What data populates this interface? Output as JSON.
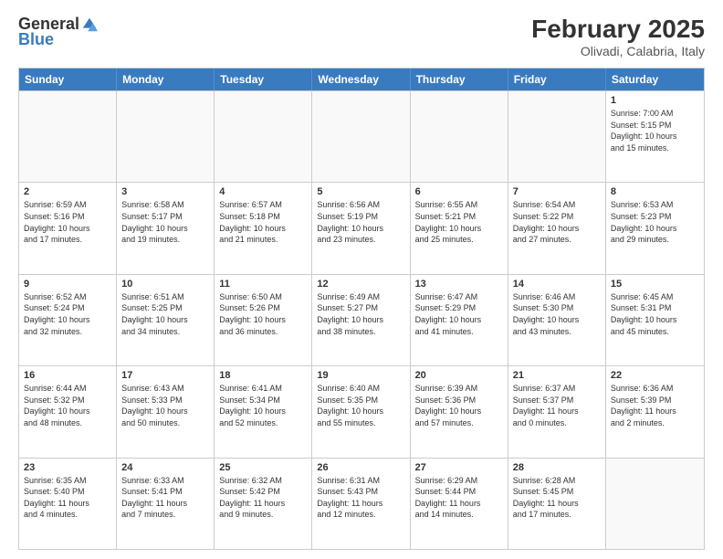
{
  "logo": {
    "general": "General",
    "blue": "Blue"
  },
  "title": {
    "month_year": "February 2025",
    "location": "Olivadi, Calabria, Italy"
  },
  "days_of_week": [
    "Sunday",
    "Monday",
    "Tuesday",
    "Wednesday",
    "Thursday",
    "Friday",
    "Saturday"
  ],
  "weeks": [
    [
      {
        "day": "",
        "info": ""
      },
      {
        "day": "",
        "info": ""
      },
      {
        "day": "",
        "info": ""
      },
      {
        "day": "",
        "info": ""
      },
      {
        "day": "",
        "info": ""
      },
      {
        "day": "",
        "info": ""
      },
      {
        "day": "1",
        "info": "Sunrise: 7:00 AM\nSunset: 5:15 PM\nDaylight: 10 hours\nand 15 minutes."
      }
    ],
    [
      {
        "day": "2",
        "info": "Sunrise: 6:59 AM\nSunset: 5:16 PM\nDaylight: 10 hours\nand 17 minutes."
      },
      {
        "day": "3",
        "info": "Sunrise: 6:58 AM\nSunset: 5:17 PM\nDaylight: 10 hours\nand 19 minutes."
      },
      {
        "day": "4",
        "info": "Sunrise: 6:57 AM\nSunset: 5:18 PM\nDaylight: 10 hours\nand 21 minutes."
      },
      {
        "day": "5",
        "info": "Sunrise: 6:56 AM\nSunset: 5:19 PM\nDaylight: 10 hours\nand 23 minutes."
      },
      {
        "day": "6",
        "info": "Sunrise: 6:55 AM\nSunset: 5:21 PM\nDaylight: 10 hours\nand 25 minutes."
      },
      {
        "day": "7",
        "info": "Sunrise: 6:54 AM\nSunset: 5:22 PM\nDaylight: 10 hours\nand 27 minutes."
      },
      {
        "day": "8",
        "info": "Sunrise: 6:53 AM\nSunset: 5:23 PM\nDaylight: 10 hours\nand 29 minutes."
      }
    ],
    [
      {
        "day": "9",
        "info": "Sunrise: 6:52 AM\nSunset: 5:24 PM\nDaylight: 10 hours\nand 32 minutes."
      },
      {
        "day": "10",
        "info": "Sunrise: 6:51 AM\nSunset: 5:25 PM\nDaylight: 10 hours\nand 34 minutes."
      },
      {
        "day": "11",
        "info": "Sunrise: 6:50 AM\nSunset: 5:26 PM\nDaylight: 10 hours\nand 36 minutes."
      },
      {
        "day": "12",
        "info": "Sunrise: 6:49 AM\nSunset: 5:27 PM\nDaylight: 10 hours\nand 38 minutes."
      },
      {
        "day": "13",
        "info": "Sunrise: 6:47 AM\nSunset: 5:29 PM\nDaylight: 10 hours\nand 41 minutes."
      },
      {
        "day": "14",
        "info": "Sunrise: 6:46 AM\nSunset: 5:30 PM\nDaylight: 10 hours\nand 43 minutes."
      },
      {
        "day": "15",
        "info": "Sunrise: 6:45 AM\nSunset: 5:31 PM\nDaylight: 10 hours\nand 45 minutes."
      }
    ],
    [
      {
        "day": "16",
        "info": "Sunrise: 6:44 AM\nSunset: 5:32 PM\nDaylight: 10 hours\nand 48 minutes."
      },
      {
        "day": "17",
        "info": "Sunrise: 6:43 AM\nSunset: 5:33 PM\nDaylight: 10 hours\nand 50 minutes."
      },
      {
        "day": "18",
        "info": "Sunrise: 6:41 AM\nSunset: 5:34 PM\nDaylight: 10 hours\nand 52 minutes."
      },
      {
        "day": "19",
        "info": "Sunrise: 6:40 AM\nSunset: 5:35 PM\nDaylight: 10 hours\nand 55 minutes."
      },
      {
        "day": "20",
        "info": "Sunrise: 6:39 AM\nSunset: 5:36 PM\nDaylight: 10 hours\nand 57 minutes."
      },
      {
        "day": "21",
        "info": "Sunrise: 6:37 AM\nSunset: 5:37 PM\nDaylight: 11 hours\nand 0 minutes."
      },
      {
        "day": "22",
        "info": "Sunrise: 6:36 AM\nSunset: 5:39 PM\nDaylight: 11 hours\nand 2 minutes."
      }
    ],
    [
      {
        "day": "23",
        "info": "Sunrise: 6:35 AM\nSunset: 5:40 PM\nDaylight: 11 hours\nand 4 minutes."
      },
      {
        "day": "24",
        "info": "Sunrise: 6:33 AM\nSunset: 5:41 PM\nDaylight: 11 hours\nand 7 minutes."
      },
      {
        "day": "25",
        "info": "Sunrise: 6:32 AM\nSunset: 5:42 PM\nDaylight: 11 hours\nand 9 minutes."
      },
      {
        "day": "26",
        "info": "Sunrise: 6:31 AM\nSunset: 5:43 PM\nDaylight: 11 hours\nand 12 minutes."
      },
      {
        "day": "27",
        "info": "Sunrise: 6:29 AM\nSunset: 5:44 PM\nDaylight: 11 hours\nand 14 minutes."
      },
      {
        "day": "28",
        "info": "Sunrise: 6:28 AM\nSunset: 5:45 PM\nDaylight: 11 hours\nand 17 minutes."
      },
      {
        "day": "",
        "info": ""
      }
    ]
  ]
}
